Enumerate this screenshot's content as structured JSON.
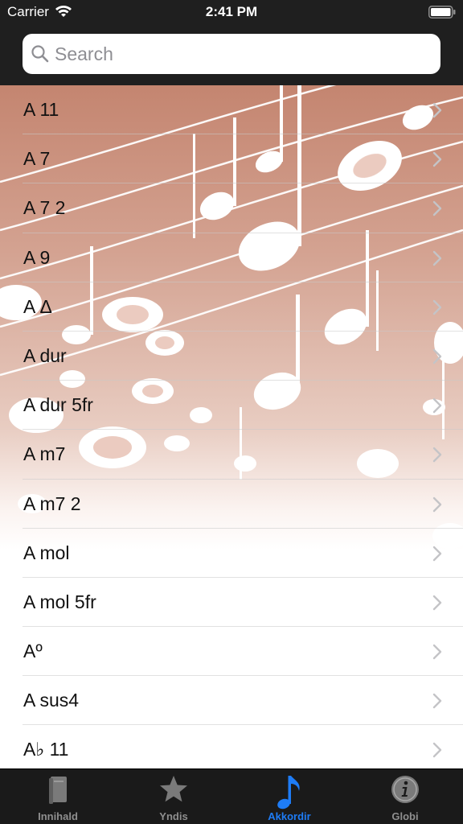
{
  "status_bar": {
    "carrier": "Carrier",
    "time": "2:41 PM",
    "wifi_icon": "wifi-icon",
    "battery_icon": "battery-icon"
  },
  "search": {
    "placeholder": "Search",
    "value": "",
    "icon": "search-icon"
  },
  "chords": [
    {
      "label": "A 11"
    },
    {
      "label": "A 7"
    },
    {
      "label": "A 7 2"
    },
    {
      "label": "A 9"
    },
    {
      "label": "A Δ"
    },
    {
      "label": "A dur"
    },
    {
      "label": "A dur 5fr"
    },
    {
      "label": "A m7"
    },
    {
      "label": "A m7 2"
    },
    {
      "label": "A mol"
    },
    {
      "label": "A mol 5fr"
    },
    {
      "label": "Aº"
    },
    {
      "label": "A sus4"
    },
    {
      "label": "A♭ 11"
    }
  ],
  "tabs": [
    {
      "label": "Innihald",
      "icon": "book-icon",
      "active": false
    },
    {
      "label": "Yndis",
      "icon": "star-icon",
      "active": false
    },
    {
      "label": "Akkordir",
      "icon": "music-note-icon",
      "active": true
    },
    {
      "label": "Globi",
      "icon": "info-icon",
      "active": false
    }
  ],
  "colors": {
    "bar_background": "#1f1f1f",
    "accent": "#1e7cf6",
    "tab_inactive": "#8f8f8f",
    "list_gradient_top": "#c48570"
  }
}
